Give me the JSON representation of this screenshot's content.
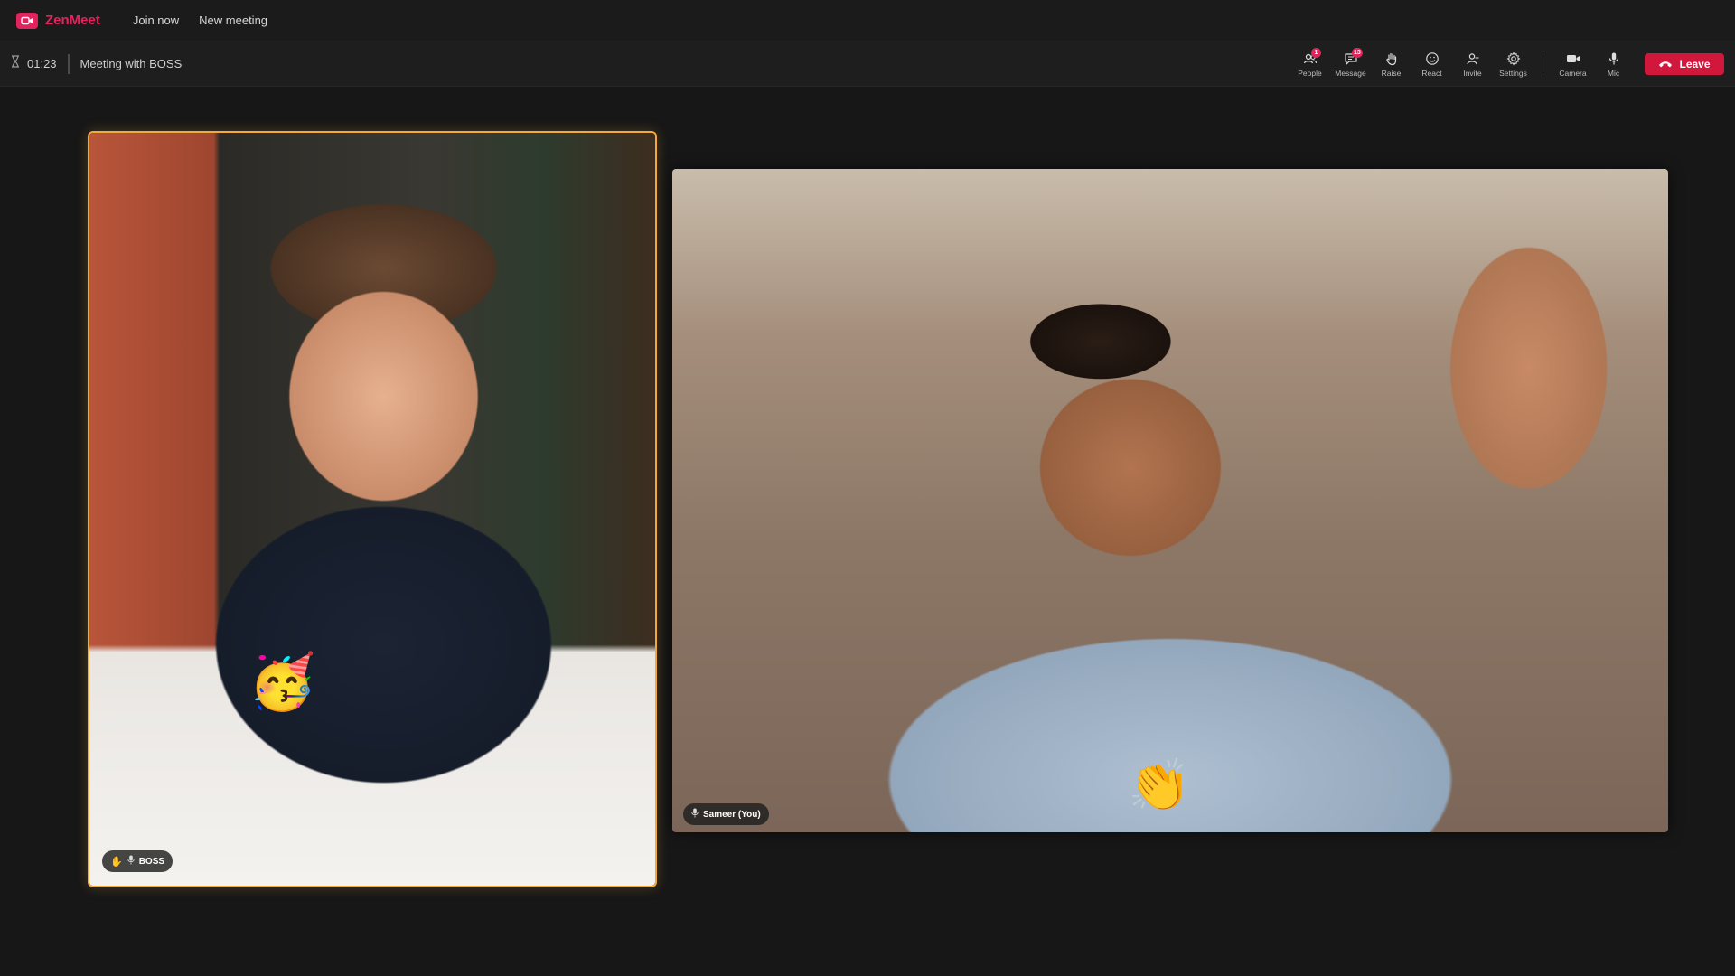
{
  "app": {
    "brand_name": "ZenMeet",
    "nav": [
      "Join now",
      "New meeting"
    ],
    "accent_color": "#e0245e"
  },
  "meeting": {
    "timer": "01:23",
    "title": "Meeting with BOSS"
  },
  "toolbar": {
    "people": {
      "label": "People",
      "badge": "1",
      "icon": "people-icon"
    },
    "message": {
      "label": "Message",
      "badge": "13",
      "icon": "chat-icon"
    },
    "raise": {
      "label": "Raise",
      "icon": "hand-icon"
    },
    "react": {
      "label": "React",
      "icon": "smile-icon"
    },
    "invite": {
      "label": "Invite",
      "icon": "add-person-icon"
    },
    "settings": {
      "label": "Settings",
      "icon": "gear-icon"
    },
    "camera": {
      "label": "Camera",
      "icon": "camera-icon"
    },
    "mic": {
      "label": "Mic",
      "icon": "mic-icon"
    },
    "leave": {
      "label": "Leave",
      "icon": "hangup-icon",
      "color": "#d2173d"
    }
  },
  "participants": [
    {
      "name": "BOSS",
      "hand_raised": true,
      "reaction": "🥳",
      "highlight_color": "#f3a93c"
    },
    {
      "name": "Sameer (You)",
      "hand_raised": false,
      "reaction": "👏"
    }
  ]
}
